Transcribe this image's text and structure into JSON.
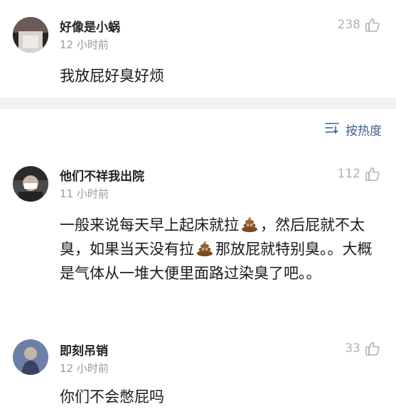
{
  "comments": [
    {
      "author": "好像是小蜗",
      "time": "12 小时前",
      "likes": "238",
      "text": "我放屁好臭好烦"
    },
    {
      "author": "他们不祥我出院",
      "time": "11 小时前",
      "likes": "112",
      "text_parts": [
        "一般来说每天早上起床就拉",
        "，然后屁就不太臭，如果当天没有拉",
        "那放屁就特别臭。。大概是气体从一堆大便里面路过染臭了吧。。"
      ]
    },
    {
      "author": "即刻吊销",
      "time": "12 小时前",
      "likes": "33",
      "text": "你们不会憋屁吗"
    }
  ],
  "sort": {
    "label": "按热度",
    "icon": "sort-icon"
  },
  "icons": {
    "like": "thumbs-up-icon",
    "emoji": "poop-emoji-icon"
  },
  "colors": {
    "accent": "#3d5f88",
    "muted": "#9a9a9a",
    "divider": "#f1f1f1"
  }
}
